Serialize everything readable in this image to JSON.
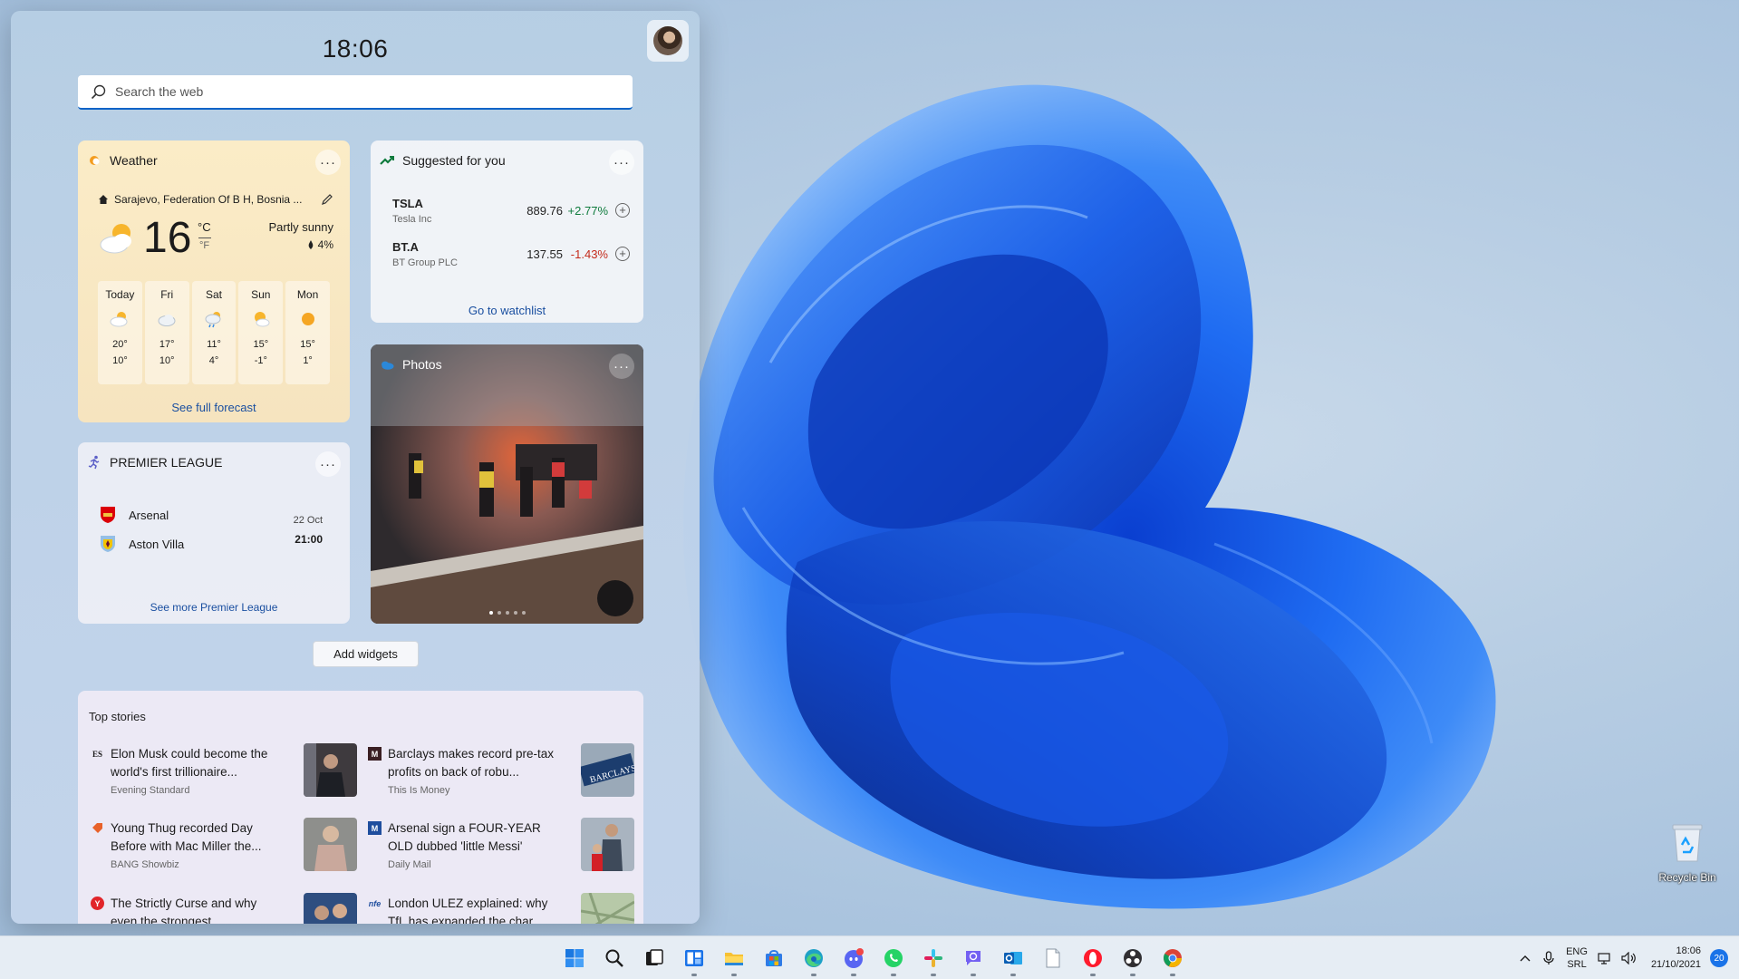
{
  "widgets": {
    "clock": "18:06",
    "search": {
      "placeholder": "Search the web"
    },
    "weather": {
      "title": "Weather",
      "location": "Sarajevo, Federation Of B H, Bosnia ...",
      "temp": "16",
      "unit_c": "°C",
      "unit_f": "°F",
      "condition": "Partly sunny",
      "precip": "4%",
      "days": [
        {
          "day": "Today",
          "icon": "partly-cloudy-icon",
          "hi": "20°",
          "lo": "10°"
        },
        {
          "day": "Fri",
          "icon": "cloudy-icon",
          "hi": "17°",
          "lo": "10°"
        },
        {
          "day": "Sat",
          "icon": "rain-icon",
          "hi": "11°",
          "lo": "4°"
        },
        {
          "day": "Sun",
          "icon": "partly-sunny-icon",
          "hi": "15°",
          "lo": "-1°"
        },
        {
          "day": "Mon",
          "icon": "sunny-icon",
          "hi": "15°",
          "lo": "1°"
        }
      ],
      "link": "See full forecast"
    },
    "stocks": {
      "title": "Suggested for you",
      "items": [
        {
          "symbol": "TSLA",
          "name": "Tesla Inc",
          "price": "889.76",
          "change": "+2.77%",
          "color": "#0f7b3d"
        },
        {
          "symbol": "BT.A",
          "name": "BT Group PLC",
          "price": "137.55",
          "change": "-1.43%",
          "color": "#c42b1c"
        }
      ],
      "link": "Go to watchlist"
    },
    "photos": {
      "title": "Photos"
    },
    "league": {
      "title": "PREMIER LEAGUE",
      "home": "Arsenal",
      "away": "Aston Villa",
      "date": "22 Oct",
      "time": "21:00",
      "link": "See more Premier League"
    },
    "add_widgets": "Add widgets",
    "top_stories": {
      "title": "Top stories",
      "items": [
        {
          "headline": "Elon Musk could become the world's first trillionaire...",
          "source": "Evening Standard",
          "logo": "ES"
        },
        {
          "headline": "Barclays makes record pre-tax profits on back of robu...",
          "source": "This Is Money",
          "logo": "M"
        },
        {
          "headline": "Young Thug recorded Day Before with Mac Miller the...",
          "source": "BANG Showbiz",
          "logo": ""
        },
        {
          "headline": "Arsenal sign a FOUR-YEAR OLD dubbed 'little Messi'",
          "source": "Daily Mail",
          "logo": "M"
        },
        {
          "headline": "The Strictly Curse and why even the strongest...",
          "source": "",
          "logo": "Y"
        },
        {
          "headline": "London ULEZ explained: why TfL has expanded the char...",
          "source": "",
          "logo": "nfe"
        }
      ]
    }
  },
  "desktop": {
    "recycle_bin": "Recycle Bin"
  },
  "taskbar": {
    "apps": [
      "start-icon",
      "search-icon",
      "task-view-icon",
      "widgets-icon",
      "file-explorer-icon",
      "store-icon",
      "edge-icon",
      "discord-icon",
      "whatsapp-icon",
      "slack-icon",
      "viber-icon",
      "outlook-icon",
      "notepad-icon",
      "opera-icon",
      "obs-icon",
      "chrome-icon"
    ],
    "lang": "ENG",
    "layout": "SRL",
    "time": "18:06",
    "date": "21/10/2021",
    "notifications": "20"
  },
  "colors": {
    "accent": "#0b63c7",
    "link": "#1a4fa0",
    "positive": "#0f7b3d",
    "negative": "#c42b1c"
  }
}
